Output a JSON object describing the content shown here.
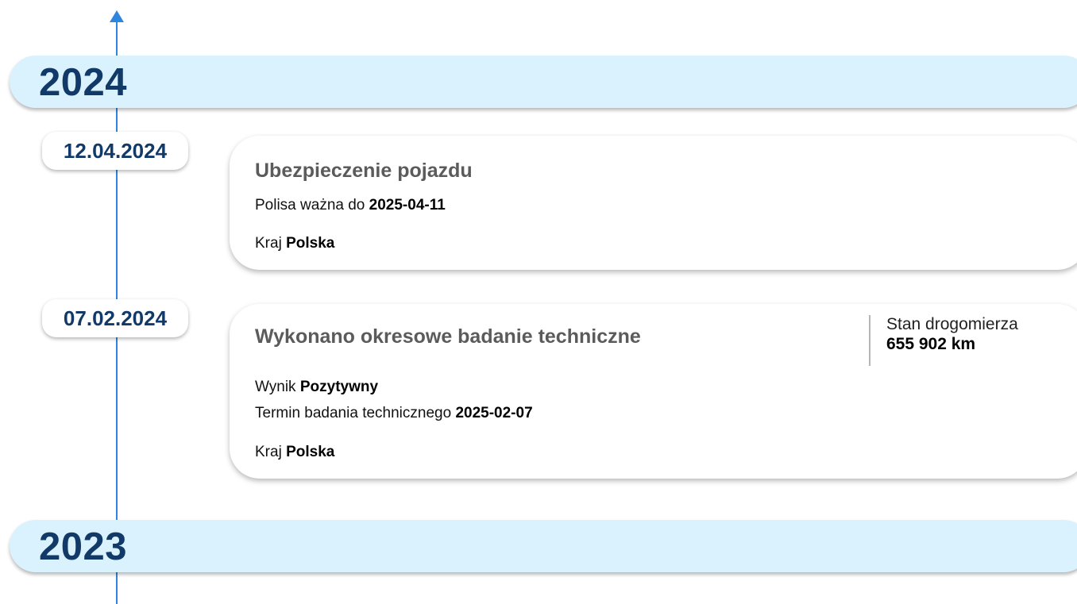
{
  "timeline": {
    "years": [
      {
        "label": "2024"
      },
      {
        "label": "2023"
      }
    ],
    "events": [
      {
        "date": "12.04.2024",
        "title": "Ubezpieczenie pojazdu",
        "policy_label": "Polisa ważna do",
        "policy_value": "2025-04-11",
        "country_label": "Kraj",
        "country_value": "Polska"
      },
      {
        "date": "07.02.2024",
        "title": "Wykonano okresowe badanie techniczne",
        "odometer_label": "Stan drogomierza",
        "odometer_value": "655 902 km",
        "result_label": "Wynik",
        "result_value": "Pozytywny",
        "deadline_label": "Termin badania technicznego",
        "deadline_value": "2025-02-07",
        "country_label": "Kraj",
        "country_value": "Polska"
      }
    ]
  },
  "colors": {
    "axis": "#2e86de",
    "year_band": "#daf2fd",
    "year_text": "#123a68",
    "title_text": "#5b5b5b"
  },
  "icons": {
    "axis_arrow": "arrow-up-icon"
  }
}
